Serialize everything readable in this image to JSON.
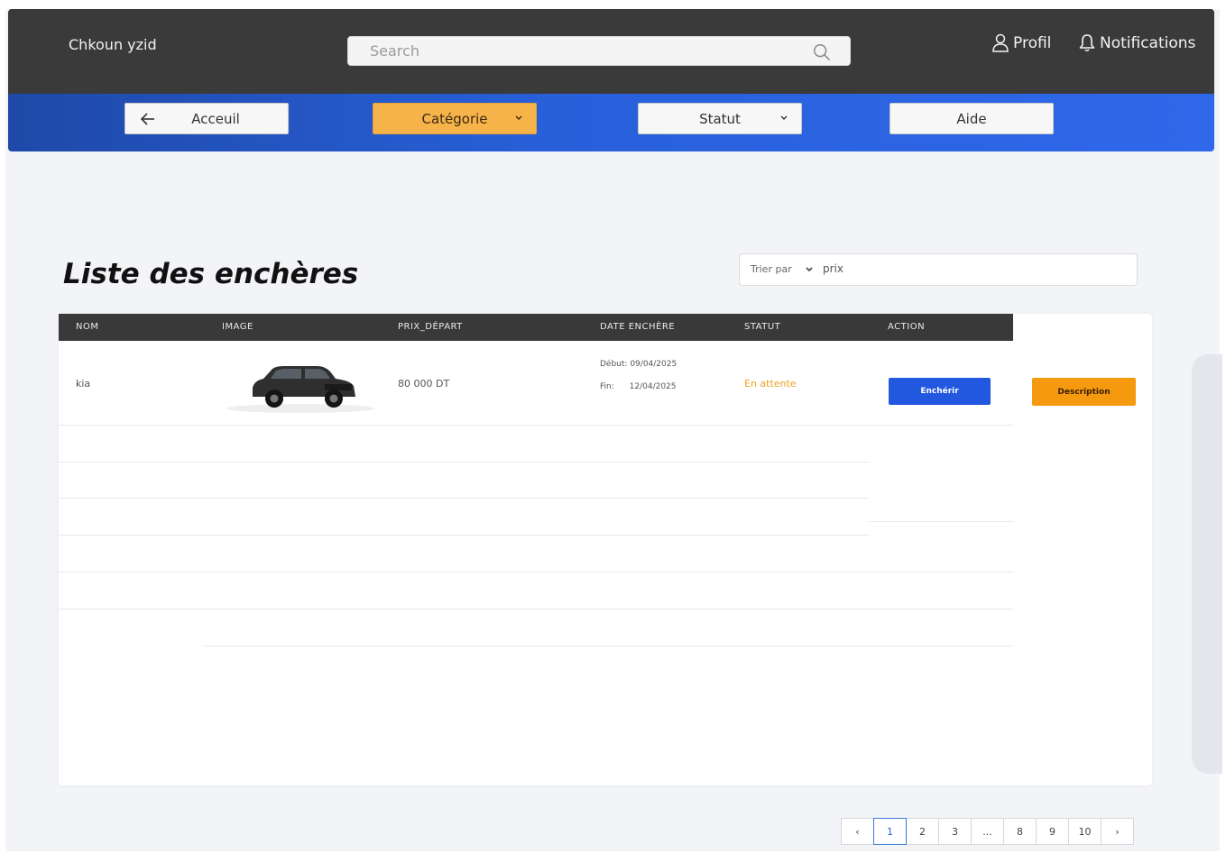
{
  "header": {
    "brand": "Chkoun yzid",
    "search_placeholder": "Search",
    "profile_label": "Profil",
    "notifications_label": "Notifications"
  },
  "nav": {
    "home_label": "Acceuil",
    "category_label": "Catégorie",
    "status_label": "Statut",
    "help_label": "Aide"
  },
  "main": {
    "title": "Liste des enchères",
    "sort": {
      "label": "Trier par",
      "value": "prix"
    }
  },
  "table": {
    "columns": [
      "NOM",
      "IMAGE",
      "PRIX_DÉPART",
      "DATE ENCHÈRE",
      "STATUT",
      "ACTION"
    ],
    "rows": [
      {
        "name": "kia",
        "price": "80 000 DT",
        "start_label": "Début:",
        "start_date": "09/04/2025",
        "end_label": "Fin:",
        "end_date": "12/04/2025",
        "status": "En attente",
        "bid_label": "Enchérir",
        "description_label": "Description"
      }
    ]
  },
  "pagination": {
    "prev": "‹",
    "pages": [
      "1",
      "2",
      "3",
      "...",
      "8",
      "9",
      "10"
    ],
    "next": "›",
    "current": "1"
  },
  "colors": {
    "topbar": "#3a3a3a",
    "navbar": "#2860da",
    "accent_yellow": "#f5b34a",
    "bid_blue": "#2257e0",
    "description_orange": "#f5990f",
    "status_pending": "#f0a020"
  }
}
